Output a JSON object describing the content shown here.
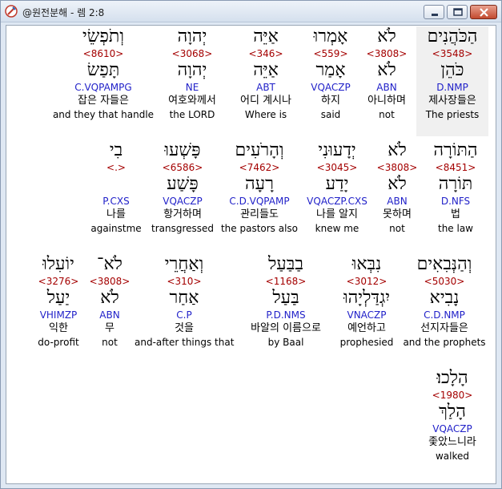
{
  "window": {
    "title": "@원전분해 - 렘 2:8"
  },
  "words": [
    {
      "hebrew": "הַכֹּהֲנִים",
      "strong": "<3548>",
      "lemma": "כֹּהֵן",
      "parse": "D.NMP",
      "korean": "제사장들은",
      "english": "The priests",
      "selected": true
    },
    {
      "hebrew": "לֹא",
      "strong": "<3808>",
      "lemma": "לֹא",
      "parse": "ABN",
      "korean": "아니하며",
      "english": "not"
    },
    {
      "hebrew": "אָמְרוּ",
      "strong": "<559>",
      "lemma": "אָמַר",
      "parse": "VQACZP",
      "korean": "하지",
      "english": "said"
    },
    {
      "hebrew": "אַיֵּה",
      "strong": "<346>",
      "lemma": "אַיֵּה",
      "parse": "ABT",
      "korean": "어디 계시나",
      "english": "Where is"
    },
    {
      "hebrew": "יְהוָה",
      "strong": "<3068>",
      "lemma": "יְהוָה",
      "parse": "NE",
      "korean": "여호와께서",
      "english": "the LORD"
    },
    {
      "hebrew": "וְתֹפְשֵׂי",
      "strong": "<8610>",
      "lemma": "תָּפַשׂ",
      "parse": "C.VQPAMPG",
      "korean": "잡은 자들은",
      "english": "and they that handle"
    },
    {
      "hebrew": "הַתּוֹרָה",
      "strong": "<8451>",
      "lemma": "תּוֹרָה",
      "parse": "D.NFS",
      "korean": "법",
      "english": "the law"
    },
    {
      "hebrew": "לֹא",
      "strong": "<3808>",
      "lemma": "לֹא",
      "parse": "ABN",
      "korean": "못하며",
      "english": "not"
    },
    {
      "hebrew": "יְדָעוּנִי",
      "strong": "<3045>",
      "lemma": "יָדַע",
      "parse": "VQACZP.CXS",
      "korean": "나를 알지",
      "english": "knew me"
    },
    {
      "hebrew": "וְהָרֹעִים",
      "strong": "<7462>",
      "lemma": "רָעָה",
      "parse": "C.D.VQPAMP",
      "korean": "관리들도",
      "english": "the pastors also"
    },
    {
      "hebrew": "פָּשְׁעוּ",
      "strong": "<6586>",
      "lemma": "פָּשַׁע",
      "parse": "VQACZP",
      "korean": "항거하며",
      "english": "transgressed"
    },
    {
      "hebrew": "בִי",
      "strong": "<.>",
      "lemma": "",
      "parse": "P.CXS",
      "korean": "나를",
      "english": "againstme"
    },
    {
      "hebrew": "וְהַנְּבִאִים",
      "strong": "<5030>",
      "lemma": "נָבִיא",
      "parse": "C.D.NMP",
      "korean": "선지자들은",
      "english": "and the prophets"
    },
    {
      "hebrew": "נִבְּאוּ",
      "strong": "<3012>",
      "lemma": "יִגְדַּלְיָהוּ",
      "parse": "VNACZP",
      "korean": "예언하고",
      "english": "prophesied"
    },
    {
      "hebrew": "בַבַּעַל",
      "strong": "<1168>",
      "lemma": "בַּעַל",
      "parse": "P.D.NMS",
      "korean": "바알의 이름으로",
      "english": "by Baal"
    },
    {
      "hebrew": "וְאַחֲרֵי",
      "strong": "<310>",
      "lemma": "אַחַר",
      "parse": "C.P",
      "korean": "것을",
      "english": "and-after things that"
    },
    {
      "hebrew": "לֹא־",
      "strong": "<3808>",
      "lemma": "לֹא",
      "parse": "ABN",
      "korean": "무",
      "english": "not"
    },
    {
      "hebrew": "יוֹעִלוּ",
      "strong": "<3276>",
      "lemma": "יַעַל",
      "parse": "VHIMZP",
      "korean": "익한",
      "english": "do-profit"
    },
    {
      "hebrew": "הָלָכוּ׃",
      "strong": "<1980>",
      "lemma": "הָלַךְ",
      "parse": "VQACZP",
      "korean": "좇았느니라",
      "english": "walked"
    }
  ]
}
